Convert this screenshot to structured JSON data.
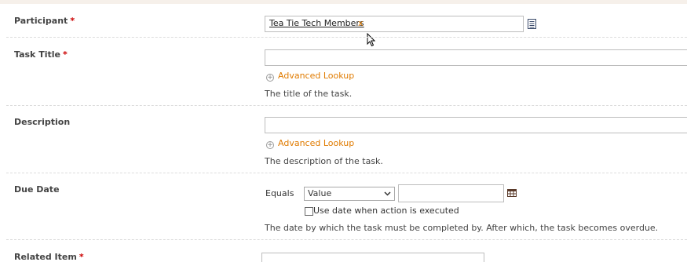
{
  "fields": {
    "participant": {
      "label": "Participant",
      "required_mark": "*",
      "token": "Tea Tie Tech Members",
      "token_remove": "x"
    },
    "task_title": {
      "label": "Task Title",
      "required_mark": "*",
      "lookup": "Advanced Lookup",
      "help": "The title of the task.",
      "value": ""
    },
    "description": {
      "label": "Description",
      "lookup": "Advanced Lookup",
      "help": "The description of the task.",
      "value": ""
    },
    "due_date": {
      "label": "Due Date",
      "operator": "Equals",
      "select_value": "Value",
      "date_value": "",
      "checkbox_label": "Use date when action is executed",
      "checkbox_checked": false,
      "help": "The date by which the task must be completed by. After which, the task becomes overdue."
    },
    "related_item": {
      "label": "Related Item",
      "required_mark": "*"
    }
  },
  "icons": {
    "participant_picker": "list-icon",
    "date_picker": "calendar-icon",
    "lookup": "plus-circle-icon",
    "select": "chevron-down-icon",
    "pointer": "mouse-cursor-icon"
  },
  "colors": {
    "accent": "#e07b00",
    "required": "#cc0000",
    "label": "#444444"
  }
}
